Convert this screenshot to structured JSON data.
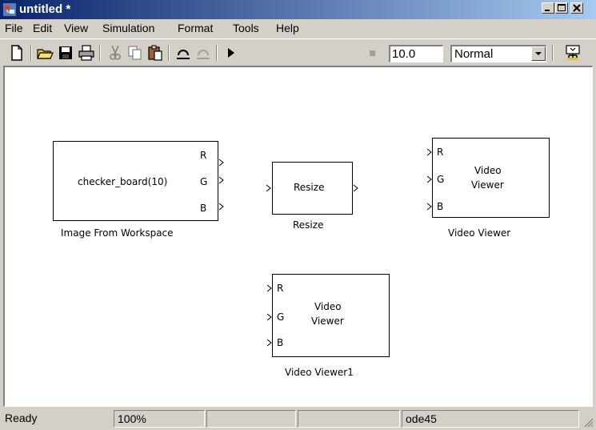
{
  "window": {
    "title": "untitled *"
  },
  "menu": {
    "items": [
      "File",
      "Edit",
      "View",
      "Simulation",
      "Format",
      "Tools",
      "Help"
    ]
  },
  "toolbar": {
    "icons": [
      "new-icon",
      "open-icon",
      "save-icon",
      "print-icon",
      "cut-icon",
      "copy-icon",
      "paste-icon",
      "undo-icon",
      "redo-icon",
      "play-icon",
      "stop-icon",
      "library-icon"
    ],
    "stop_time": "10.0",
    "sim_mode": "Normal"
  },
  "blocks": {
    "image_from_workspace": {
      "body": "checker_board(10)",
      "ports": [
        "R",
        "G",
        "B"
      ],
      "caption": "Image From Workspace"
    },
    "resize": {
      "body": "Resize",
      "caption": "Resize"
    },
    "video_viewer": {
      "body_line1": "Video",
      "body_line2": "Viewer",
      "ports": [
        "R",
        "G",
        "B"
      ],
      "caption": "Video Viewer"
    },
    "video_viewer1": {
      "body_line1": "Video",
      "body_line2": "Viewer",
      "ports": [
        "R",
        "G",
        "B"
      ],
      "caption": "Video Viewer1"
    }
  },
  "status": {
    "state": "Ready",
    "zoom": "100%",
    "solver": "ode45"
  }
}
